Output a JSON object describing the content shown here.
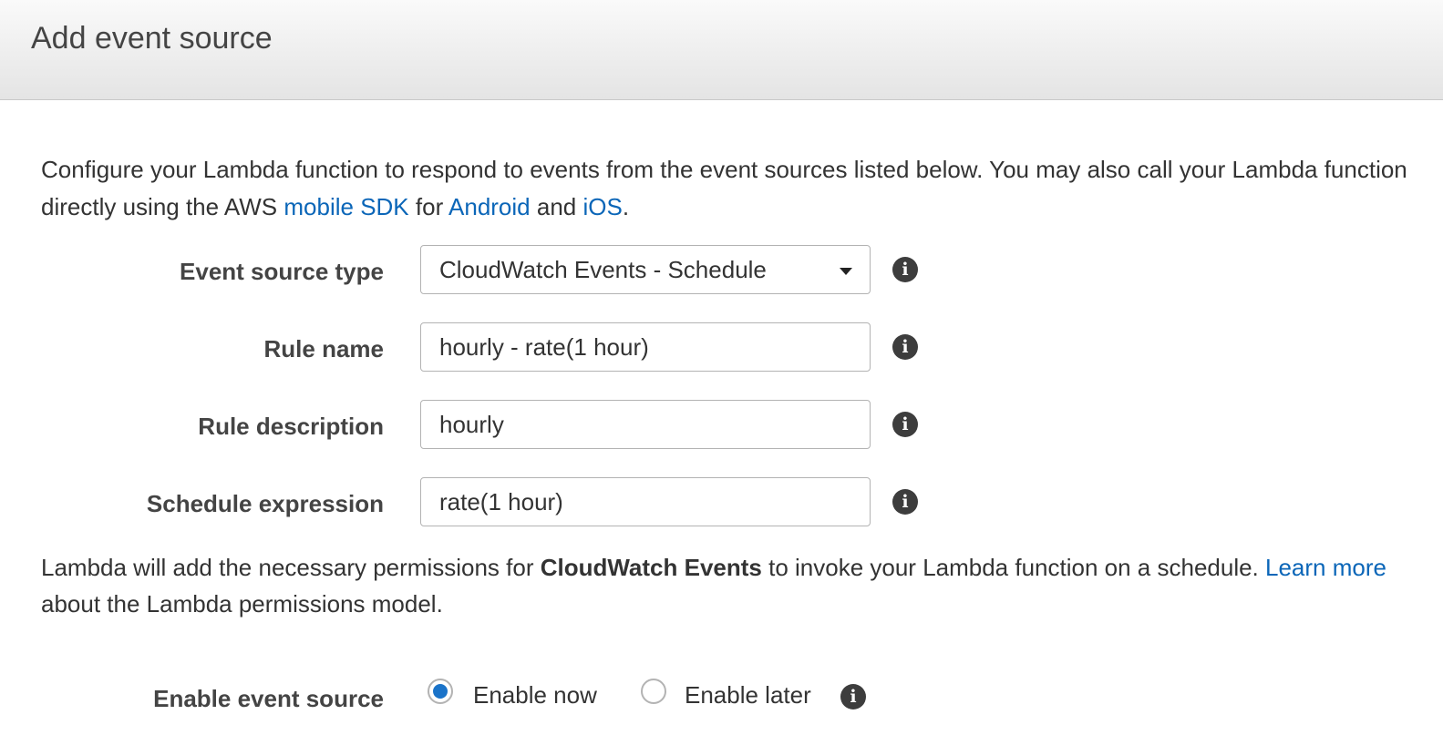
{
  "header": {
    "title": "Add event source"
  },
  "intro": {
    "text_1": "Configure your Lambda function to respond to events from the event sources listed below. You may also call your Lambda function directly using the AWS ",
    "link_mobile_sdk": "mobile SDK",
    "text_2": " for ",
    "link_android": "Android",
    "text_3": " and ",
    "link_ios": "iOS",
    "text_4": "."
  },
  "form": {
    "event_source_type": {
      "label": "Event source type",
      "value": "CloudWatch Events - Schedule"
    },
    "rule_name": {
      "label": "Rule name",
      "value": "hourly - rate(1 hour)"
    },
    "rule_description": {
      "label": "Rule description",
      "value": "hourly"
    },
    "schedule_expression": {
      "label": "Schedule expression",
      "value": "rate(1 hour)"
    },
    "info_icon": "i"
  },
  "permissions": {
    "text_1": "Lambda will add the necessary permissions for ",
    "bold": "CloudWatch Events",
    "text_2": " to invoke your Lambda function on a schedule. ",
    "link_learn_more": "Learn more",
    "text_3": " about the Lambda permissions model."
  },
  "enable": {
    "label": "Enable event source",
    "options": [
      {
        "label": "Enable now",
        "selected": true
      },
      {
        "label": "Enable later",
        "selected": false
      }
    ]
  },
  "colors": {
    "link": "#0b66b8",
    "radio_selected": "#1a73c9",
    "info_icon_bg": "#3d3d3d"
  }
}
